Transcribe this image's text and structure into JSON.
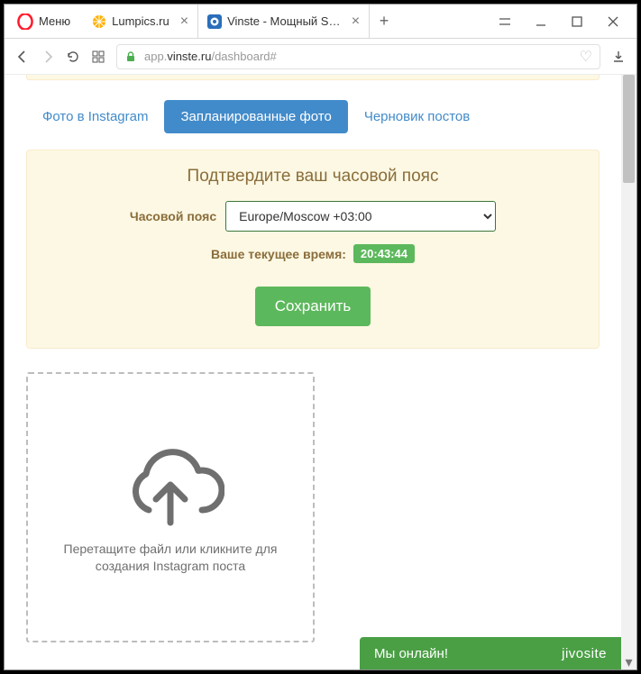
{
  "browser": {
    "menu_label": "Меню",
    "tabs": [
      {
        "title": "Lumpics.ru",
        "active": false
      },
      {
        "title": "Vinste - Мощный SMM-се",
        "active": true
      }
    ],
    "url_prefix": "app.",
    "url_host": "vinste.ru",
    "url_path": "/dashboard#"
  },
  "nav": {
    "tab_photo": "Фото в Instagram",
    "tab_scheduled": "Запланированные фото",
    "tab_drafts": "Черновик постов"
  },
  "tz": {
    "title": "Подтвердите ваш часовой пояс",
    "label": "Часовой пояс",
    "selected": "Europe/Moscow +03:00",
    "current_time_label": "Ваше текущее время:",
    "current_time_value": "20:43:44",
    "save_label": "Сохранить"
  },
  "dropzone": {
    "text": "Перетащите файл или кликните для создания Instagram поста"
  },
  "jivo": {
    "status": "Мы онлайн!",
    "brand": "jivosite"
  }
}
